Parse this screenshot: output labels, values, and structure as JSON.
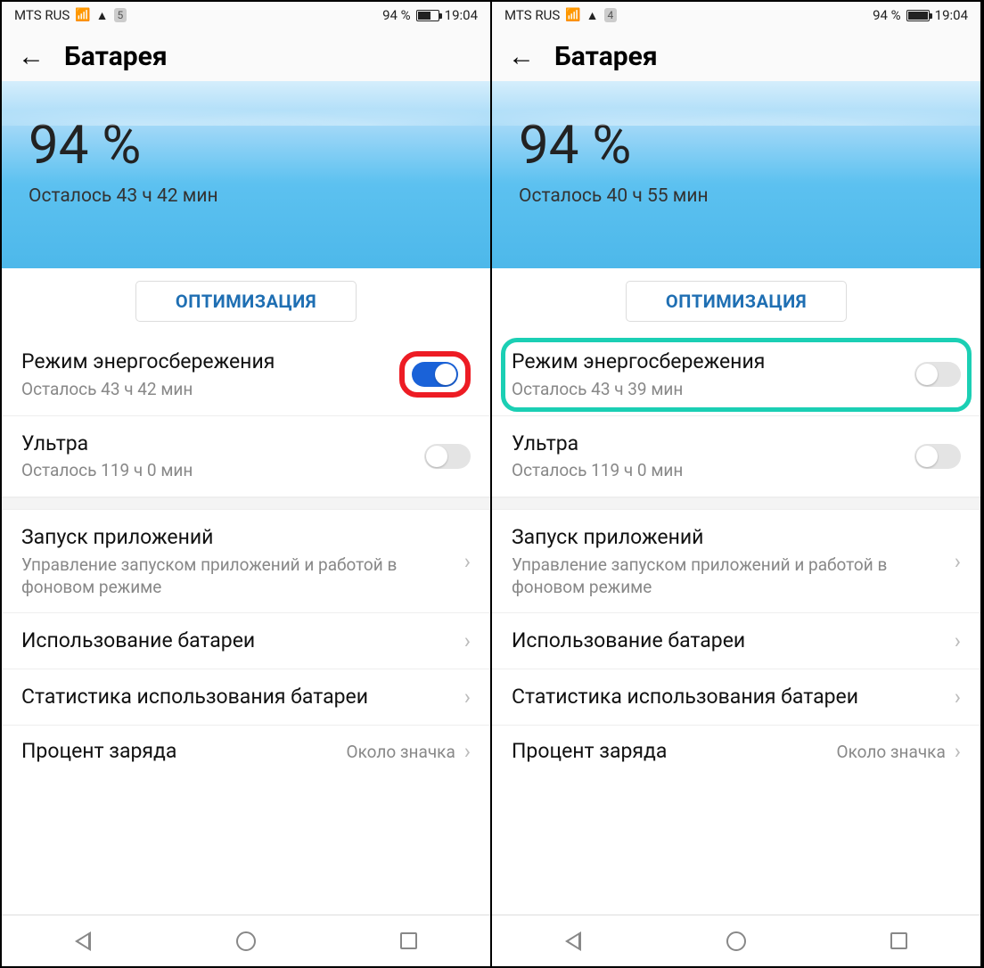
{
  "left": {
    "status": {
      "carrier": "MTS RUS",
      "notif": "5",
      "battery_pct": "94 %",
      "time": "19:04",
      "battery_fill_pct": 58
    },
    "header": {
      "title": "Батарея"
    },
    "hero": {
      "pct": "94 %",
      "remaining": "Осталось 43 ч 42 мин"
    },
    "optimize": "ОПТИМИЗАЦИЯ",
    "power_save": {
      "title": "Режим энергосбережения",
      "sub": "Осталось 43 ч 42 мин",
      "on": true
    },
    "ultra": {
      "title": "Ультра",
      "sub": "Осталось 119 ч 0 мин",
      "on": false
    },
    "apps": {
      "title": "Запуск приложений",
      "sub": "Управление запуском приложений и работой в фоновом режиме"
    },
    "usage": {
      "title": "Использование батареи"
    },
    "stats": {
      "title": "Статистика использования батареи"
    },
    "percent_row": {
      "title": "Процент заряда",
      "value": "Около значка"
    }
  },
  "right": {
    "status": {
      "carrier": "MTS RUS",
      "notif": "4",
      "battery_pct": "94 %",
      "time": "19:04",
      "battery_fill_pct": 94
    },
    "header": {
      "title": "Батарея"
    },
    "hero": {
      "pct": "94 %",
      "remaining": "Осталось 40 ч 55 мин"
    },
    "optimize": "ОПТИМИЗАЦИЯ",
    "power_save": {
      "title": "Режим энергосбережения",
      "sub": "Осталось 43 ч 39 мин",
      "on": false
    },
    "ultra": {
      "title": "Ультра",
      "sub": "Осталось 119 ч 0 мин",
      "on": false
    },
    "apps": {
      "title": "Запуск приложений",
      "sub": "Управление запуском приложений и работой в фоновом режиме"
    },
    "usage": {
      "title": "Использование батареи"
    },
    "stats": {
      "title": "Статистика использования батареи"
    },
    "percent_row": {
      "title": "Процент заряда",
      "value": "Около значка"
    }
  }
}
